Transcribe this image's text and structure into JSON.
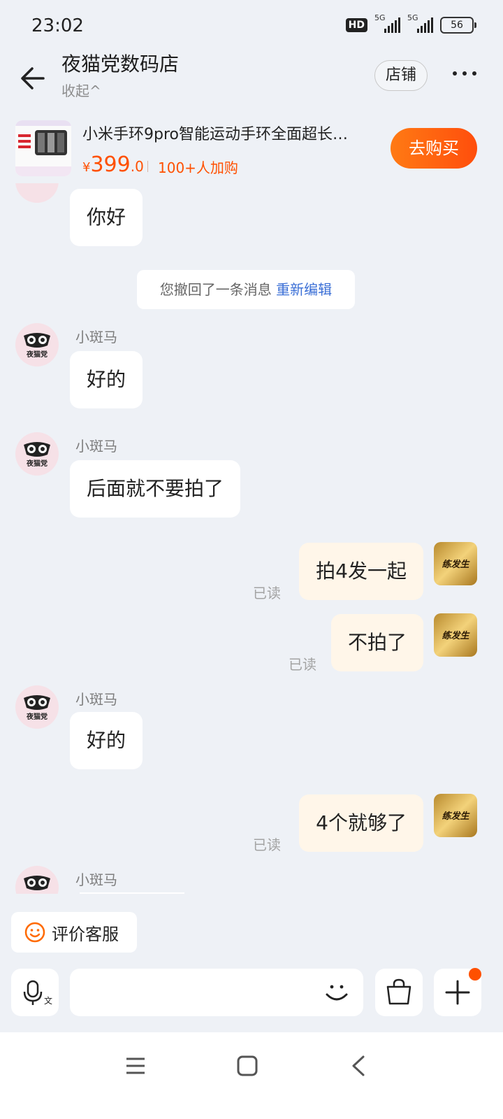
{
  "status": {
    "time": "23:02",
    "hd": "HD",
    "net1": "5G",
    "net2": "5G",
    "battery": "56"
  },
  "header": {
    "shop_name": "夜猫党数码店",
    "collapse_label": "收起^",
    "store_button": "店铺"
  },
  "product": {
    "title": "小米手环9pro智能运动手环全面超长…",
    "price_currency": "¥",
    "price_int": "399",
    "price_dec": ".0",
    "added_count": "100+人加购",
    "buy_button": "去购买"
  },
  "messages": {
    "m0": {
      "text": "你好"
    },
    "system": {
      "text": "您撤回了一条消息",
      "action": "重新编辑"
    },
    "m1": {
      "sender": "小斑马",
      "text": "好的"
    },
    "m2": {
      "sender": "小斑马",
      "text": "后面就不要拍了"
    },
    "m3": {
      "text": "拍4发一起",
      "status": "已读"
    },
    "m4": {
      "text": "不拍了",
      "status": "已读"
    },
    "m5": {
      "sender": "小斑马",
      "text": "好的"
    },
    "m6": {
      "text": "4个就够了",
      "status": "已读"
    },
    "m7": {
      "sender": "小斑马"
    }
  },
  "avatar_text": {
    "shop": "夜猫党",
    "user": "练发生"
  },
  "bottom": {
    "rate_button": "评价客服",
    "voice_icon_label": "文"
  },
  "icons": [
    "back-arrow-icon",
    "more-dots-icon",
    "smile-face-icon",
    "microphone-icon",
    "emoji-icon",
    "shopping-bag-icon",
    "plus-icon",
    "menu-icon",
    "home-square-icon",
    "back-chevron-icon"
  ],
  "colors": {
    "accent": "#ff5000",
    "link": "#3b6fd6",
    "background": "#eef1f6",
    "self_bubble": "#fff6e9",
    "badge": "#ff5000"
  }
}
